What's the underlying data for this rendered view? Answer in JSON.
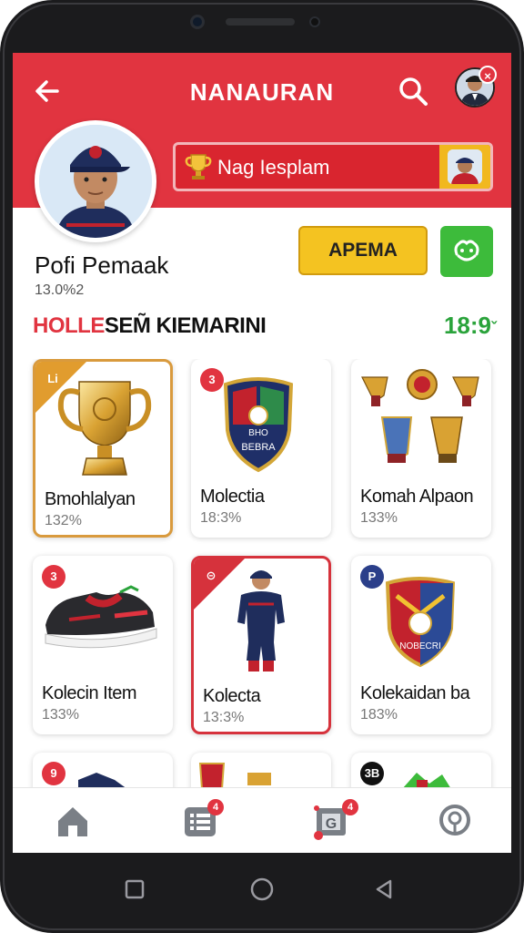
{
  "app": {
    "title": "NANAURAN"
  },
  "header": {
    "notification_badge": "×"
  },
  "banner": {
    "text": "Nag Іesplam"
  },
  "profile": {
    "name": "Pofi Pemaak",
    "subtitle": "13.0%2"
  },
  "actions": {
    "primary_label": "APEMA"
  },
  "section": {
    "title_red": "HOLLE",
    "title_dark": "SEM̃ KIEMARINI",
    "count": "18:9",
    "count_suffix": "ˇ"
  },
  "cards": [
    {
      "name": "Bmohlalyan",
      "pct": "132%",
      "badge": "Li"
    },
    {
      "name": "Molectia",
      "pct": "18:3%",
      "badge": "3"
    },
    {
      "name": "Komah Alpaon",
      "pct": "133%",
      "badge": ""
    },
    {
      "name": "Kolecin Item",
      "pct": "133%",
      "badge": "3"
    },
    {
      "name": "Kolecta",
      "pct": "13:3%",
      "badge": "⊝"
    },
    {
      "name": "Kolekaidan ba",
      "pct": "183%",
      "badge": "P"
    },
    {
      "name": "",
      "pct": "",
      "badge": "9"
    },
    {
      "name": "",
      "pct": "",
      "badge": ""
    },
    {
      "name": "",
      "pct": "",
      "badge": "3B"
    }
  ],
  "card_art_text": {
    "shield1": "BEBRA",
    "shield1_top": "BHO",
    "shield2": "NOBECRI"
  },
  "bottom_nav": [
    {
      "icon": "home-icon"
    },
    {
      "icon": "list-icon",
      "badge": "4"
    },
    {
      "icon": "collection-icon",
      "badge": "4"
    },
    {
      "icon": "location-icon"
    }
  ],
  "colors": {
    "primary_red": "#e13440",
    "gold": "#f4c321",
    "green": "#3dbb3b",
    "count_green": "#2aa33b"
  }
}
